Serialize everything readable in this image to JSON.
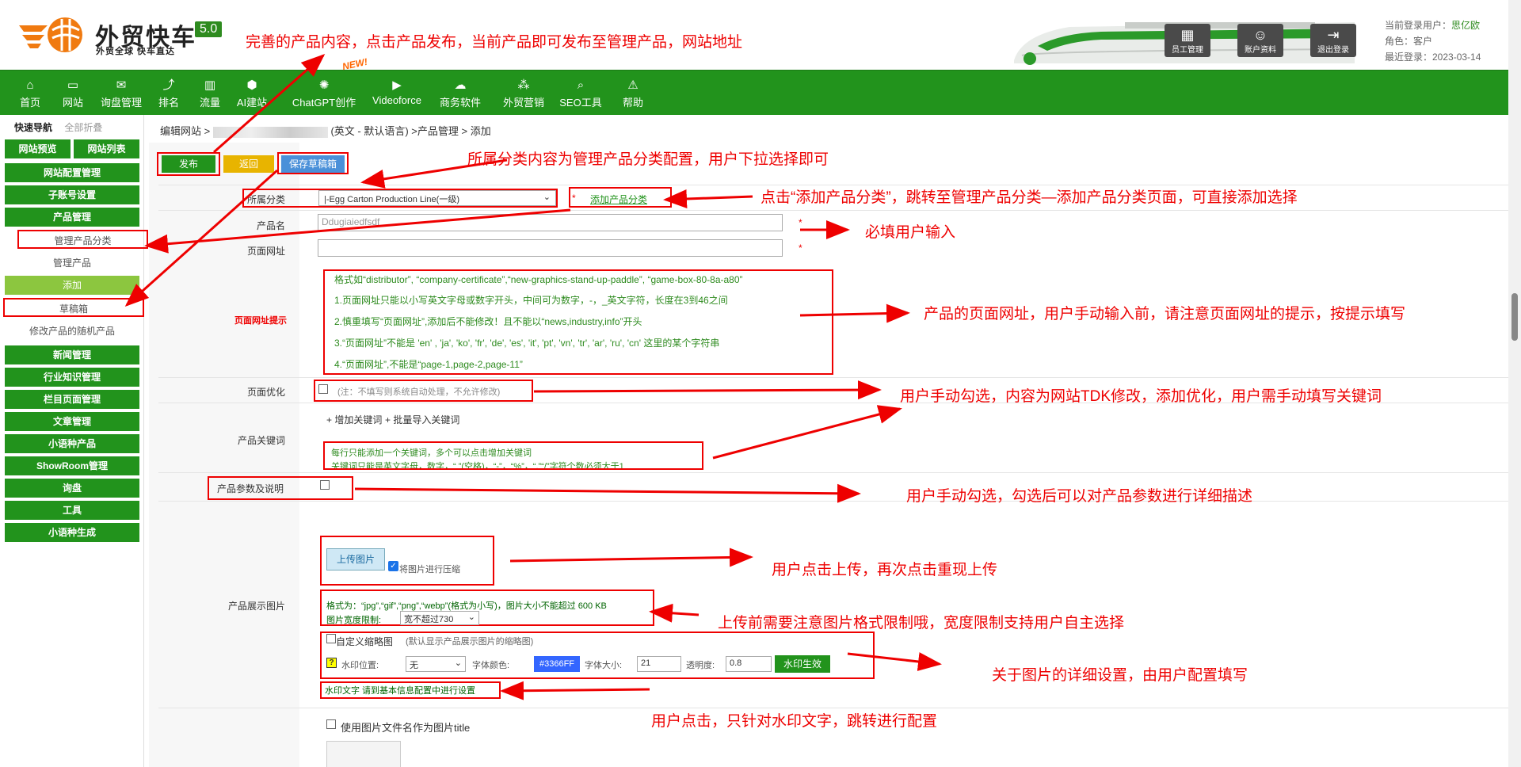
{
  "header": {
    "logo_title": "外贸快车",
    "logo_version": "5.0",
    "logo_subtitle": "外贸全球 快车直达",
    "buttons": [
      {
        "label": "员工管理",
        "icon": "staff-icon"
      },
      {
        "label": "账户资料",
        "icon": "account-icon"
      },
      {
        "label": "退出登录",
        "icon": "logout-icon"
      }
    ],
    "user_label": "当前登录用户：",
    "user_name": "思亿欧",
    "role": "角色：客户",
    "last_login": "最近登录：2023-03-14"
  },
  "nav": {
    "items": [
      {
        "label": "首页",
        "icon": "home-icon"
      },
      {
        "label": "网站",
        "icon": "monitor-icon"
      },
      {
        "label": "询盘管理",
        "icon": "mail-icon"
      },
      {
        "label": "排名",
        "icon": "rank-icon"
      },
      {
        "label": "流量",
        "icon": "chart-icon"
      },
      {
        "label": "AI建站",
        "icon": "ai-icon"
      },
      {
        "label": "ChatGPT创作",
        "icon": "chatgpt-icon"
      },
      {
        "label": "Videoforce",
        "icon": "video-icon"
      },
      {
        "label": "商务软件",
        "icon": "software-icon"
      },
      {
        "label": "外贸营销",
        "icon": "marketing-icon"
      },
      {
        "label": "SEO工具",
        "icon": "search-icon"
      },
      {
        "label": "帮助",
        "icon": "help-icon"
      }
    ],
    "new_badge": "NEW!"
  },
  "sidebar": {
    "title": "快速导航",
    "collapse_all": "全部折叠",
    "top_buttons": [
      "网站预览",
      "网站列表"
    ],
    "groups": [
      "网站配置管理",
      "子账号设置",
      "产品管理"
    ],
    "product_items": [
      "管理产品分类",
      "管理产品",
      "添加",
      "草稿箱",
      "修改产品的随机产品"
    ],
    "more_groups": [
      "新闻管理",
      "行业知识管理",
      "栏目页面管理",
      "文章管理",
      "小语种产品",
      "ShowRoom管理",
      "询盘",
      "工具",
      "小语种生成"
    ]
  },
  "breadcrumb": {
    "prefix": "编辑网站 >",
    "suffix": "(英文 - 默认语言) >产品管理 > 添加"
  },
  "toolbar": {
    "publish": "发布",
    "back": "返回",
    "save_draft": "保存草稿箱"
  },
  "form": {
    "category_label": "所属分类",
    "category_value": "|-Egg Carton Production Line(一级)",
    "add_category_link": "添加产品分类",
    "name_label": "产品名",
    "name_value": "Ddugiaiedfsdf",
    "url_label": "页面网址",
    "url_tip_label": "页面网址提示",
    "url_tips": [
      "格式如“distributor”, “company-certificate”,“new-graphics-stand-up-paddle”, “game-box-80-8a-a80”",
      "1.页面网址只能以小写英文字母或数字开头，中间可为数字，-，_英文字符，长度在3到46之间",
      "2.慎重填写“页面网址”,添加后不能修改！且不能以“news,industry,info”开头",
      "3.“页面网址”不能是 'en' , 'ja', 'ko', 'fr', 'de', 'es', 'it', 'pt', 'vn', 'tr', 'ar', 'ru', 'cn' 这里的某个字符串",
      "4.“页面网址”,不能是“page-1,page-2,page-11”"
    ],
    "seo_label": "页面优化",
    "seo_note": "(注：不填写则系统自动处理，不允许修改)",
    "keywords_label": "产品关键词",
    "add_keyword": "+ 增加关键词",
    "bulk_import": "+ 批量导入关键词",
    "keyword_tips": [
      "每行只能添加一个关键词，多个可以点击增加关键词",
      "关键词只能是英文字母，数字，“ ”(空格)，“-”，“%”，“.”“/”字符个数必须大于1"
    ],
    "params_label": "产品参数及说明",
    "images_label": "产品展示图片",
    "upload_button": "上传图片",
    "compress_label": "将图片进行压缩",
    "format_tip": "格式为：“jpg”,“gif”,“png”,“webp”(格式为小写)，图片大小不能超过 600 KB",
    "width_label": "图片宽度限制:",
    "width_value": "宽不超过730",
    "custom_thumb": "自定义缩略图",
    "custom_thumb_note": "(默认显示产品展示图片的缩略图)",
    "wm_pos_label": "水印位置:",
    "wm_pos_value": "无",
    "font_color_label": "字体颜色:",
    "font_color_value": "#3366FF",
    "font_size_label": "字体大小:",
    "font_size_value": "21",
    "opacity_label": "透明度:",
    "opacity_value": "0.8",
    "wm_apply": "水印生效",
    "wm_text_tip": "水印文字 请到基本信息配置中进行设置",
    "filename_title": "使用图片文件名作为图片title"
  },
  "annotations": [
    "完善的产品内容，点击产品发布，当前产品即可发布至管理产品，网站地址",
    "所属分类内容为管理产品分类配置，用户下拉选择即可",
    "点击“添加产品分类”，跳转至管理产品分类—添加产品分类页面，可直接添加选择",
    "必填用户输入",
    "产品的页面网址，用户手动输入前，请注意页面网址的提示，按提示填写",
    "用户手动勾选，内容为网站TDK修改，添加优化，用户需手动填写关键词",
    "用户手动勾选，勾选后可以对产品参数进行详细描述",
    "用户点击上传，再次点击重现上传",
    "上传前需要注意图片格式限制哦，宽度限制支持用户自主选择",
    "关于图片的详细设置，由用户配置填写",
    "用户点击，只针对水印文字，跳转进行配置"
  ],
  "colors": {
    "brand_green": "#22931c",
    "annotation_red": "#e00000",
    "draft_blue": "#4a90d9",
    "back_yellow": "#e8b400"
  }
}
